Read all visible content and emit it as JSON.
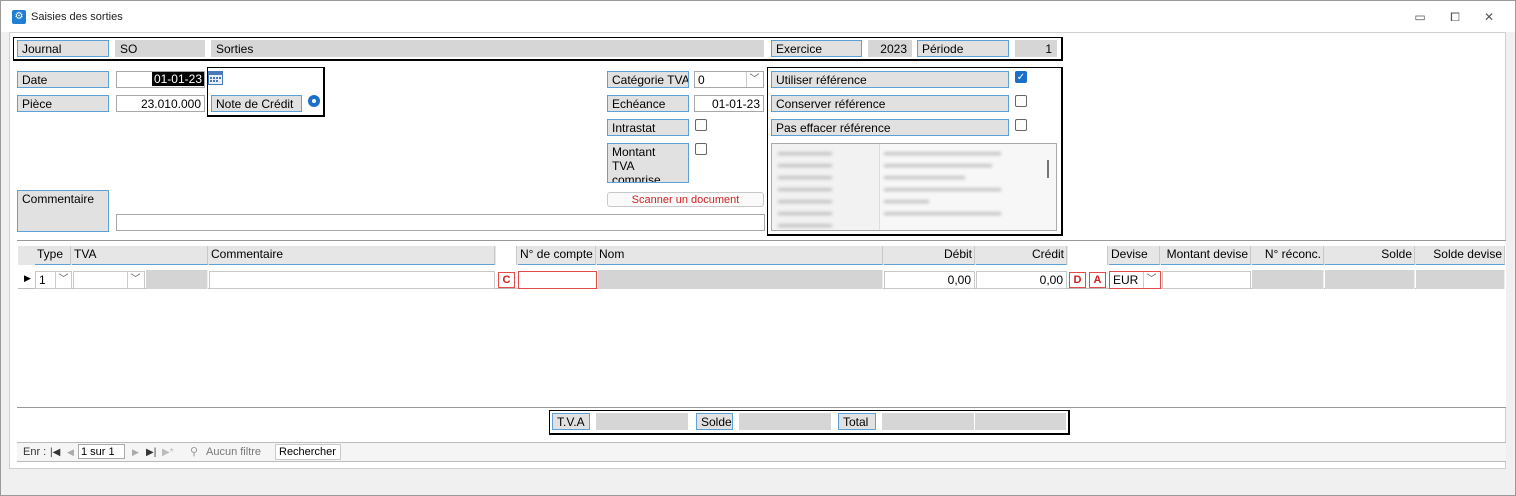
{
  "window": {
    "title": "Saisies des sorties",
    "icon": "app-form-icon",
    "controls": {
      "minimize": "▭",
      "restore": "⧠",
      "close": "✕"
    }
  },
  "header": {
    "journal_label": "Journal",
    "journal_code": "SO",
    "journal_name": "Sorties",
    "exercice_label": "Exercice",
    "exercice_value": "2023",
    "periode_label": "Période",
    "periode_value": "1"
  },
  "form": {
    "date_label": "Date",
    "date_value": "01-01-23",
    "piece_label": "Pièce",
    "piece_value": "23.010.000",
    "note_credit_label": "Note de Crédit",
    "categorie_tva_label": "Catégorie TVA",
    "categorie_tva_value": "0",
    "echeance_label": "Echéance",
    "echeance_value": "01-01-23",
    "intrastat_label": "Intrastat",
    "montant_tva_line1": "Montant",
    "montant_tva_line2": "TVA comprise",
    "scanner_label": "Scanner un document",
    "commentaire_label": "Commentaire",
    "commentaire_value": ""
  },
  "references": {
    "utiliser_label": "Utiliser référence",
    "utiliser_checked": true,
    "conserver_label": "Conserver référence",
    "conserver_checked": false,
    "pas_effacer_label": "Pas effacer référence",
    "pas_effacer_checked": false
  },
  "grid": {
    "headers": {
      "type": "Type",
      "tva": "TVA",
      "commentaire": "Commentaire",
      "compte": "N° de compte",
      "nom": "Nom",
      "debit": "Débit",
      "credit": "Crédit",
      "devise": "Devise",
      "montant_devise": "Montant devise",
      "reconc": "N° réconc.",
      "solde": "Solde",
      "solde_devise": "Solde devise"
    },
    "row": {
      "type": "1",
      "c_marker": "C",
      "debit": "0,00",
      "credit": "0,00",
      "d_marker": "D",
      "a_marker": "A",
      "devise": "EUR"
    }
  },
  "totals": {
    "tva_label": "T.V.A",
    "solde_label": "Solde",
    "total_label": "Total"
  },
  "navigation": {
    "enr_label": "Enr :",
    "position": "1 sur 1",
    "filter_label": "Aucun filtre",
    "search_label": "Rechercher"
  },
  "colors": {
    "accent": "#1a6fc9",
    "label_border": "#5ea1d6",
    "error_red": "#d32020"
  }
}
